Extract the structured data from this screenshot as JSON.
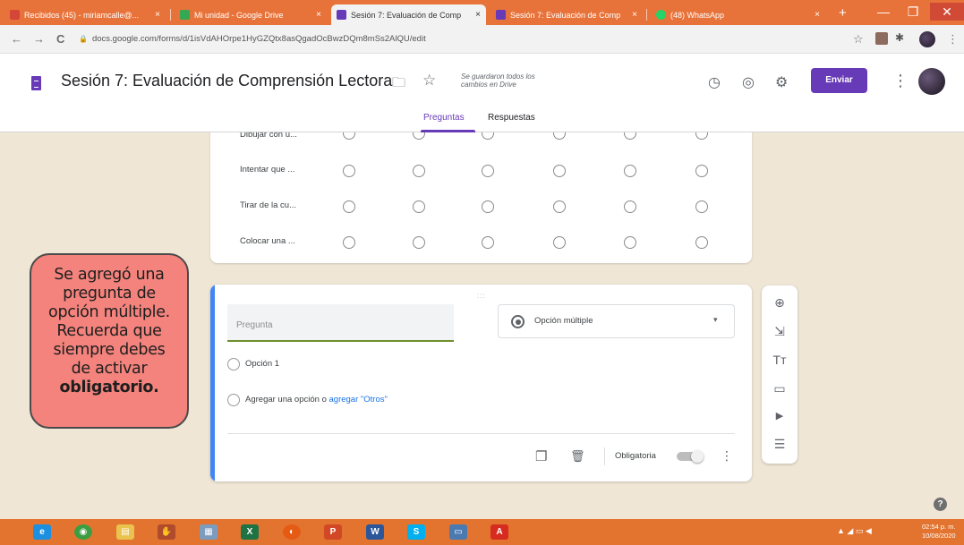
{
  "browser": {
    "tabs": [
      {
        "label": "Recibidos (45) - miriamcalle@...",
        "favicon_color": "#d44638",
        "active": false
      },
      {
        "label": "Mi unidad - Google Drive",
        "favicon_color": "#34a853",
        "active": false
      },
      {
        "label": "Sesión 7: Evaluación de Comp",
        "favicon_color": "#673ab7",
        "active": true
      },
      {
        "label": "Sesión 7: Evaluación de Comp",
        "favicon_color": "#673ab7",
        "active": false
      },
      {
        "label": "(48) WhatsApp",
        "favicon_color": "#25d366",
        "active": false
      }
    ],
    "tab_close": "×",
    "new_tab": "+",
    "minimize": "—",
    "maximize": "❐",
    "close": "✕",
    "back": "←",
    "forward": "→",
    "reload": "C",
    "url": "docs.google.com/forms/d/1isVdAHOrpe1HyGZQtx8asQgadOcBwzDQm8mSs2AlQU/edit",
    "bookmark_star": "☆",
    "menu": "⋮"
  },
  "header": {
    "title": "Sesión 7: Evaluación de Comprensión Lectora",
    "folder": "🗀",
    "star": "☆",
    "save_status": "Se guardaron todos los cambios en Drive",
    "palette": "◷",
    "preview": "◎",
    "settings": "⚙",
    "send": "Enviar",
    "more": "⋮",
    "tabs": [
      "Preguntas",
      "Respuestas"
    ]
  },
  "grid": {
    "rows": [
      "Dibujar con u...",
      "Intentar que ...",
      "Tirar de la cu...",
      "Colocar una ..."
    ]
  },
  "question": {
    "drag": ":::",
    "placeholder": "Pregunta",
    "type": "Opción múltiple",
    "caret": "▾",
    "option1": "Opción 1",
    "add_option": "Agregar una opción",
    "or": "o",
    "add_other": "agregar \"Otros\"",
    "duplicate": "❐",
    "delete": "🗑",
    "required": "Obligatoria",
    "required_on": false,
    "more": "⋮"
  },
  "toolbar": {
    "add_question": "⊕",
    "import": "⇲",
    "title": "Tт",
    "image": "▭",
    "video": "▶",
    "section": "☰"
  },
  "callout": {
    "lines": [
      "Se agregó una",
      "pregunta  de",
      "opción múltiple.",
      "Recuerda que",
      "siempre debes",
      "de activar"
    ],
    "bold": "obligatorio."
  },
  "help": "?",
  "taskbar": {
    "apps": [
      {
        "name": "ie",
        "color": "#1d8fe1",
        "glyph": "e"
      },
      {
        "name": "chrome",
        "color": "#3d9d43",
        "glyph": "◉"
      },
      {
        "name": "explorer",
        "color": "#e9c34d",
        "glyph": "▤"
      },
      {
        "name": "hand",
        "color": "#b04b2b",
        "glyph": "✋"
      },
      {
        "name": "file",
        "color": "#7b9bbf",
        "glyph": "▦"
      },
      {
        "name": "excel",
        "color": "#1f7244",
        "glyph": "X"
      },
      {
        "name": "firefox",
        "color": "#e55b13",
        "glyph": "◐"
      },
      {
        "name": "powerpoint",
        "color": "#d24726",
        "glyph": "P"
      },
      {
        "name": "word",
        "color": "#2b579a",
        "glyph": "W"
      },
      {
        "name": "skype",
        "color": "#00aff0",
        "glyph": "S"
      },
      {
        "name": "monitor",
        "color": "#4b7ab0",
        "glyph": "▭"
      },
      {
        "name": "acrobat",
        "color": "#d62b1f",
        "glyph": "A"
      }
    ],
    "tray": "▲  ◢ ▭ ◀",
    "time": "02:54 p. m.",
    "date": "10/08/2020"
  }
}
